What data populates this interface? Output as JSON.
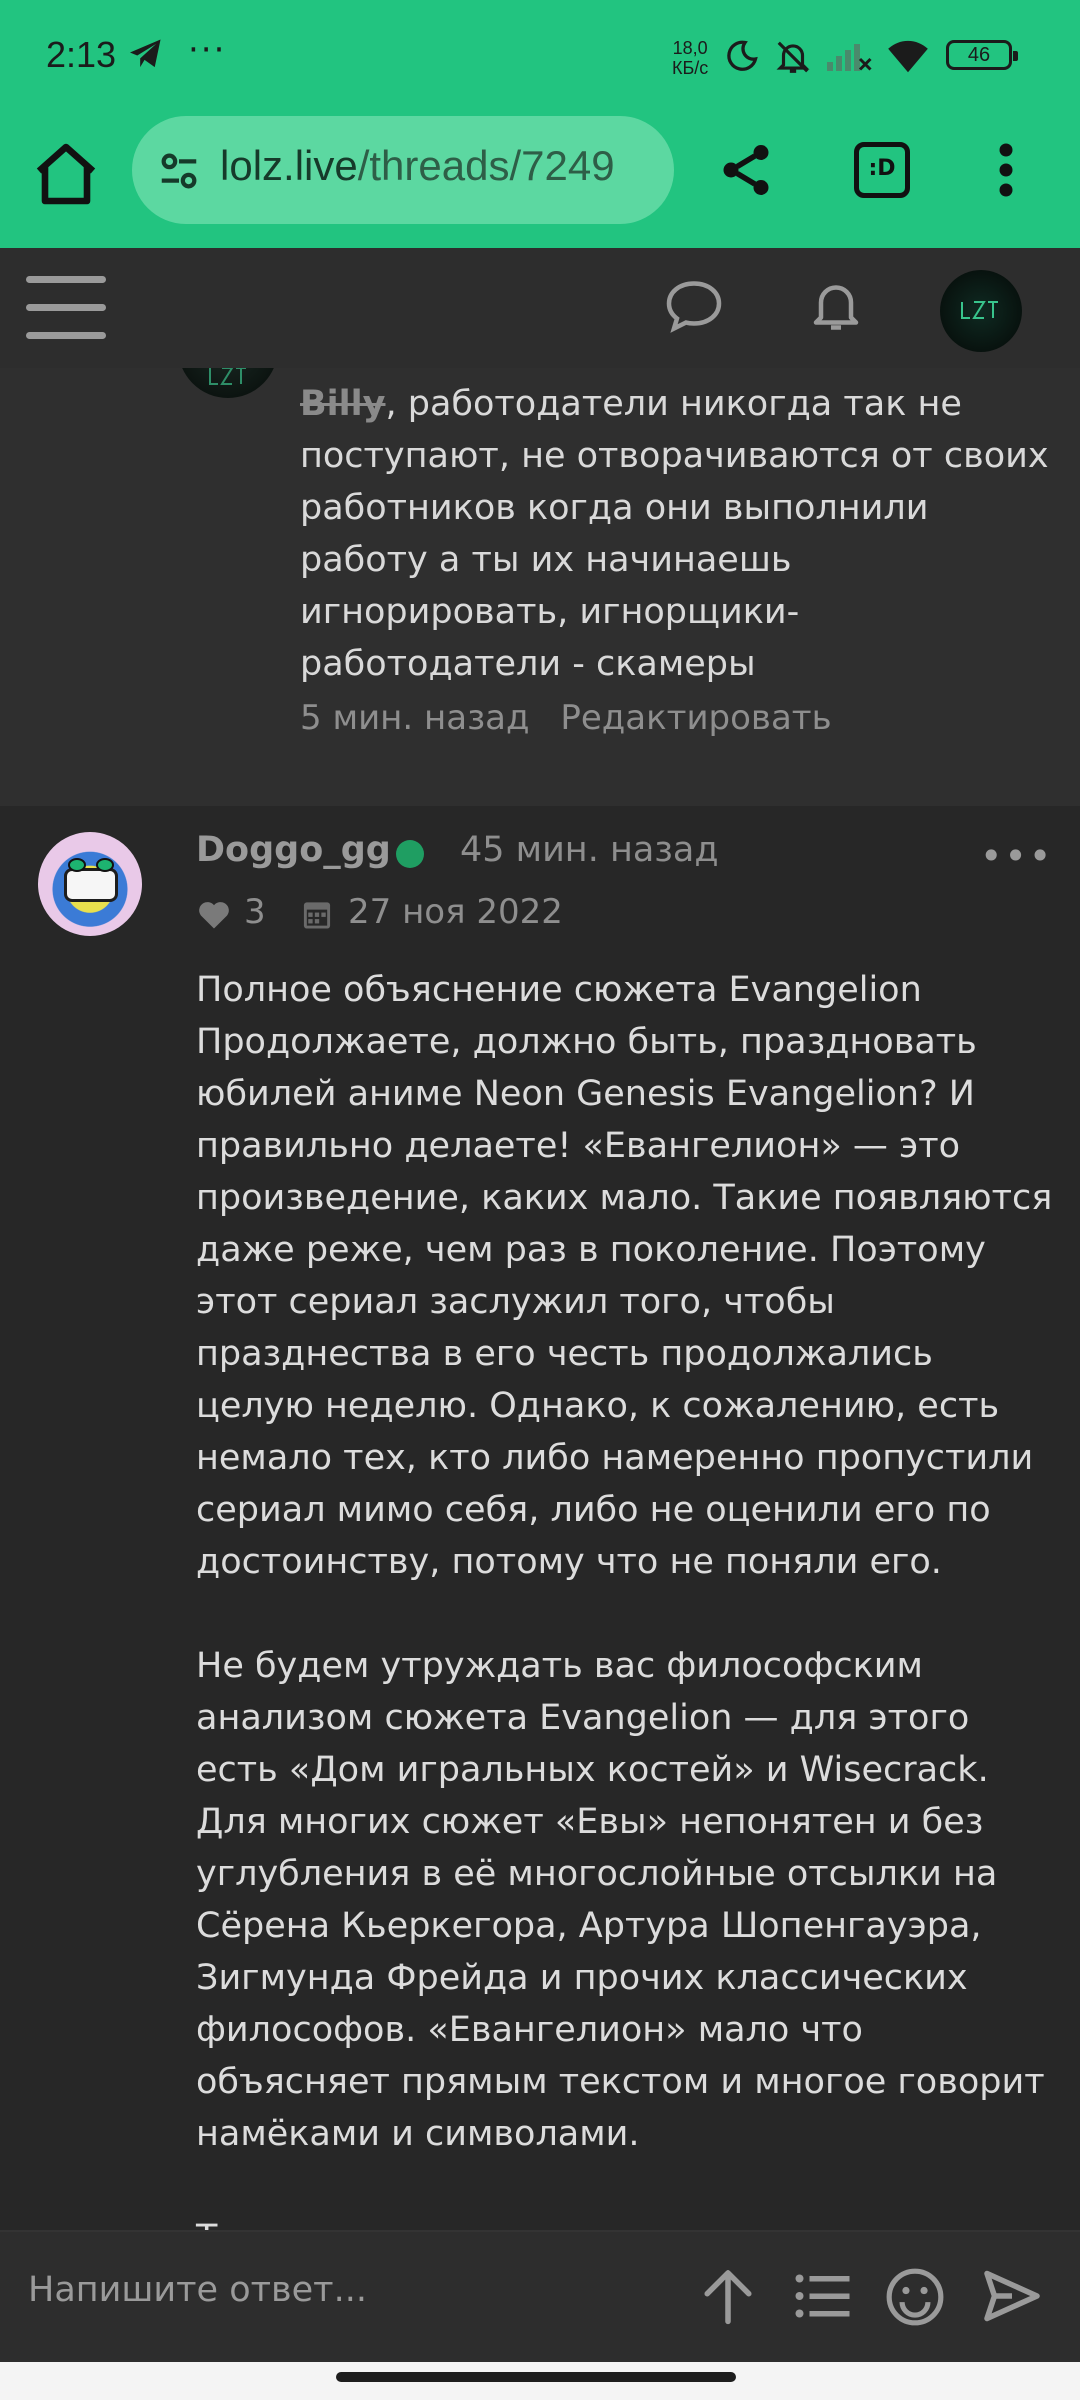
{
  "status_bar": {
    "time": "2:13",
    "menu_dots": "···",
    "net_speed_value": "18,0",
    "net_speed_unit": "КБ/с",
    "battery": "46"
  },
  "browser": {
    "url_host": "lolz.live",
    "url_path": "/threads/7249",
    "tabs_label": ":D"
  },
  "comment": {
    "mention": "Billy",
    "text": ", работодатели никогда так не поступают, не отворачиваются от своих работников когда они выполнили работу а ты их начинаешь игнорировать, игнорщики-работодатели - скамеры",
    "time": "5 мин. назад",
    "edit_label": "Редактировать"
  },
  "post": {
    "author": "Doggo_gg",
    "time": "45 мин. назад",
    "menu": "•••",
    "likes": "3",
    "join_date": "27 ноя 2022",
    "paragraphs": [
      "Полное объяснение сюжета Evangelion\nПродолжаете, должно быть, праздновать юбилей аниме Neon Genesis Evangelion? И правильно делаете! «Евангелион» — это произведение, каких мало. Такие появляются даже реже, чем раз в поколение. Поэтому этот сериал заслужил того, чтобы празднества в его честь продолжались целую неделю. Однако, к сожалению, есть немало тех, кто либо намеренно пропустили сериал мимо себя, либо не оценили его по достоинству, потому что не поняли его.",
      "Не будем утруждать вас философским анализом сюжета Evangelion — для этого есть «Дом игральных костей» и Wisecrack. Для многих сюжет «Евы» непонятен и без углубления в её многослойные отсылки на Сёрена Кьеркегора, Артура Шопенгауэра, Зигмунда Фрейда и прочих классических философов. «Евангелион» мало что объясняет прямым текстом и многое говорит намёками и символами.",
      "Т"
    ]
  },
  "reply": {
    "placeholder": "Напишите ответ..."
  },
  "colors": {
    "browser_bar": "#22c480",
    "online": "#1f9e62",
    "background": "#272727"
  }
}
